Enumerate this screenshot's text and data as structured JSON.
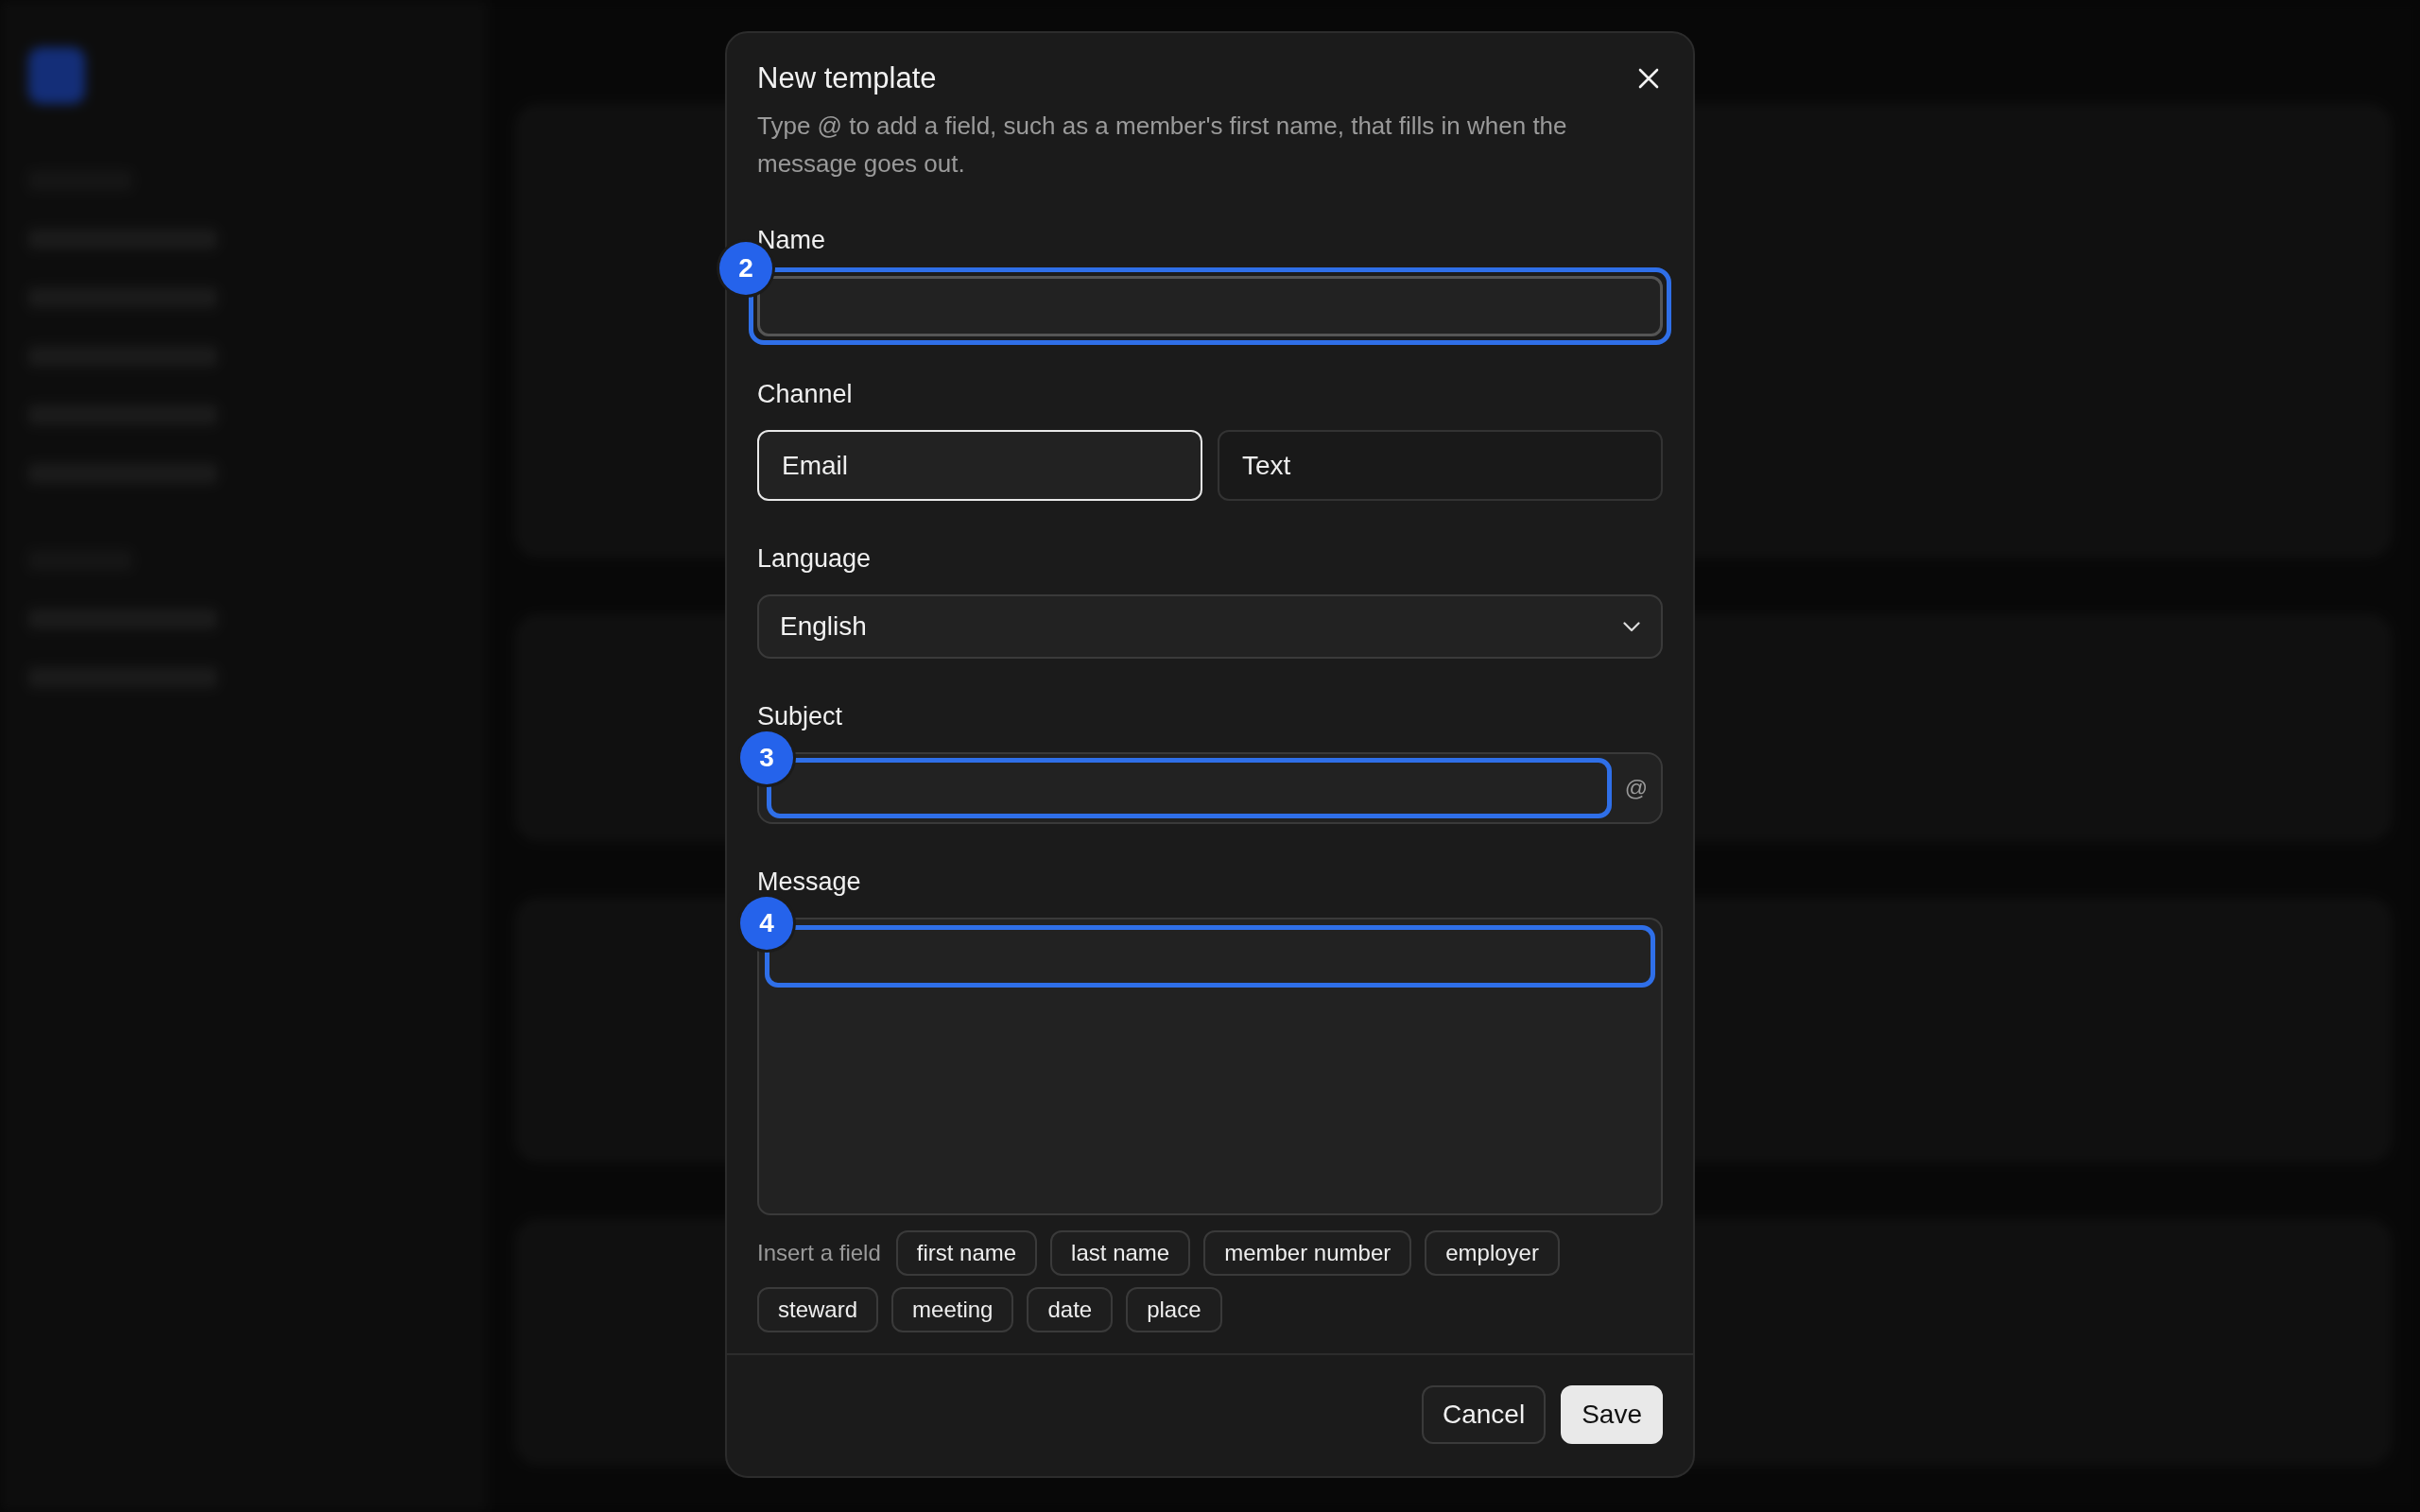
{
  "dialog": {
    "title": "New template",
    "description": "Type @ to add a field, such as a member's first name, that fills in when the message goes out.",
    "fields": [
      {
        "kind": "text",
        "label": "Name",
        "marker": "2",
        "highlighted": true
      },
      {
        "kind": "segmented",
        "label": "Channel",
        "options": [
          {
            "label": "Email",
            "selected": true
          },
          {
            "label": "Text",
            "selected": false
          }
        ]
      },
      {
        "kind": "select",
        "label": "Language",
        "value": "English"
      },
      {
        "kind": "text_with_button",
        "label": "Subject",
        "marker": "3",
        "highlighted": true,
        "button": "@"
      },
      {
        "kind": "textarea",
        "label": "Message",
        "marker": "4",
        "highlighted": true
      }
    ],
    "insert_field": {
      "label": "Insert a field",
      "chips": [
        "first name",
        "last name",
        "member number",
        "employer",
        "steward",
        "meeting",
        "date",
        "place"
      ]
    },
    "buttons": [
      {
        "label": "Cancel",
        "kind": "secondary"
      },
      {
        "label": "Save",
        "kind": "primary"
      }
    ]
  }
}
